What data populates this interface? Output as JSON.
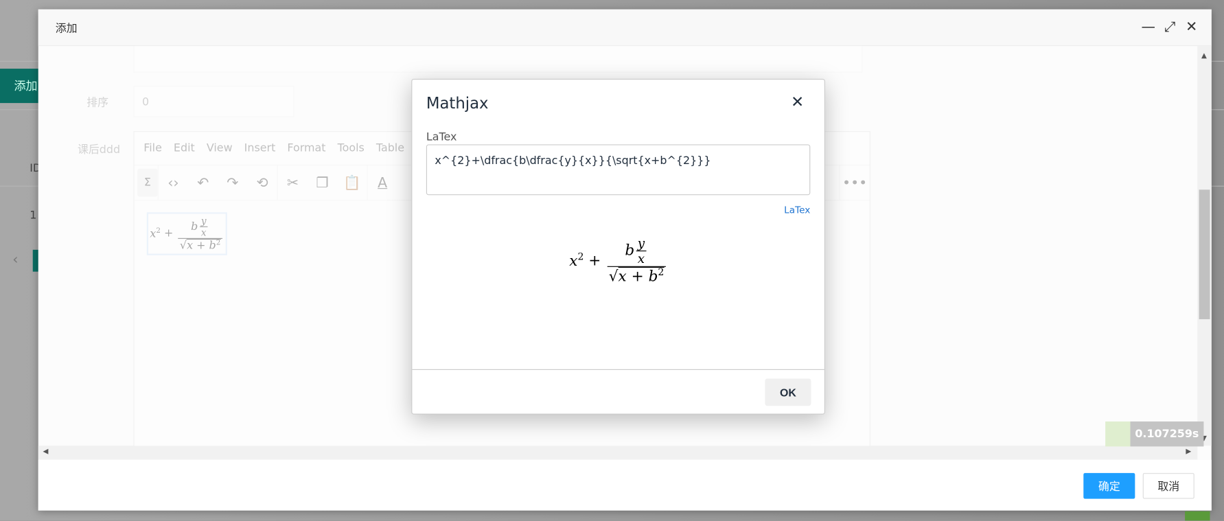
{
  "background": {
    "add_button": "添加",
    "table_header_id": "ID",
    "row_value": "1"
  },
  "window": {
    "title": "添加",
    "minimize": "—",
    "maximize": "⤢",
    "close": "✕",
    "confirm": "确定",
    "cancel": "取消"
  },
  "form": {
    "sort_label": "排序",
    "sort_value": "0",
    "content_label": "课后ddd",
    "menu": [
      "File",
      "Edit",
      "View",
      "Insert",
      "Format",
      "Tools",
      "Table"
    ],
    "toolbar_icons": [
      "sigma-icon",
      "code-icon",
      "undo-icon",
      "redo-icon",
      "history-icon",
      "cut-icon",
      "copy-icon",
      "paste-icon",
      "text-color-icon",
      "more-icon"
    ]
  },
  "dialog": {
    "title": "Mathjax",
    "close": "✕",
    "label": "LaTex",
    "latex": "x^{2}+\\dfrac{b\\dfrac{y}{x}}{\\sqrt{x+b^{2}}}",
    "link": "LaTex",
    "ok": "OK"
  },
  "timer": "0.107259s",
  "colors": {
    "primary": "#1e9fff",
    "link": "#2276d2",
    "teal": "#0a6e63"
  }
}
